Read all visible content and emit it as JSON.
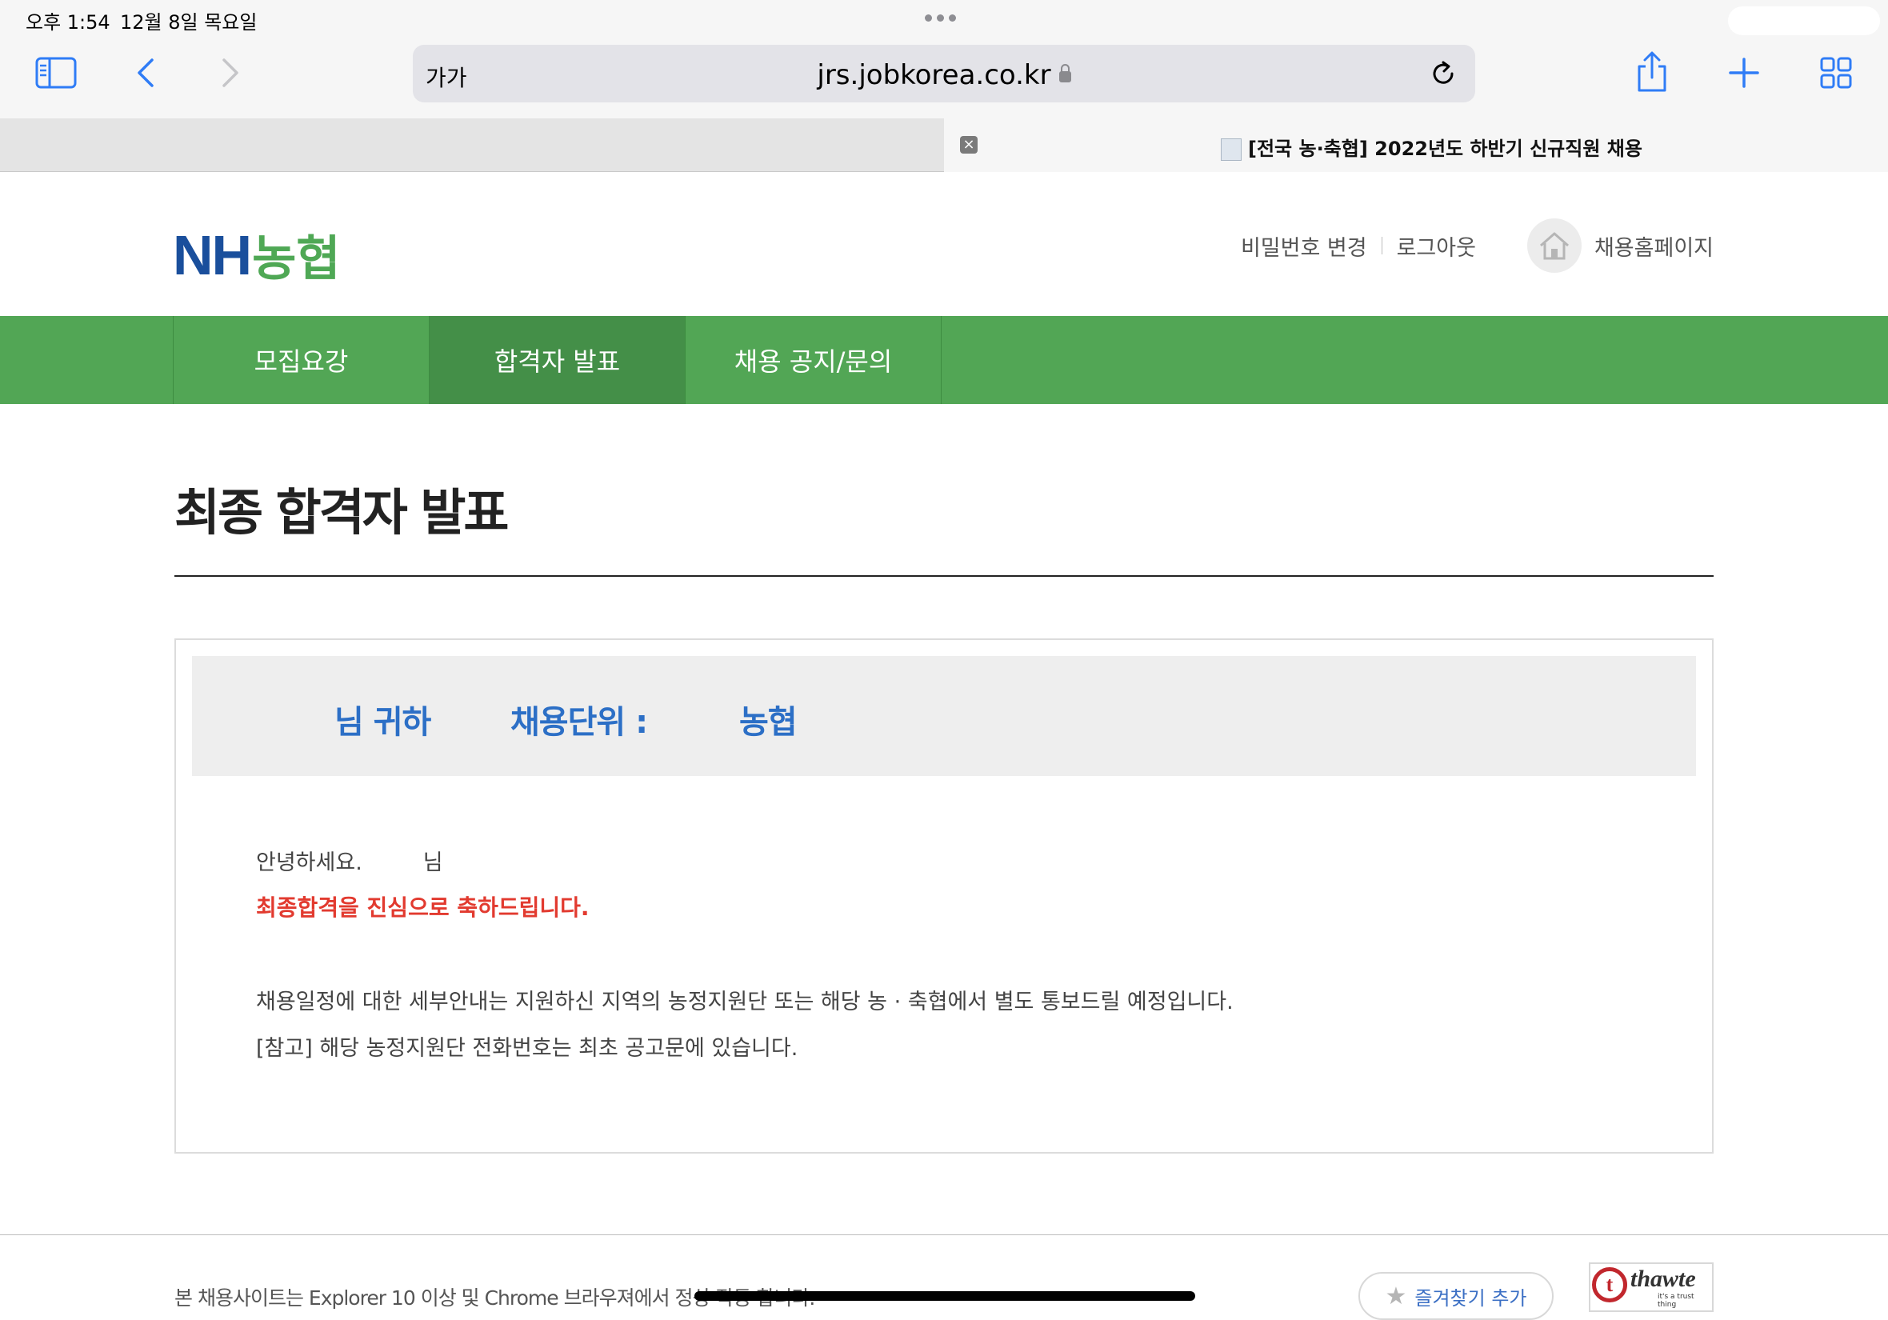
{
  "status_bar": {
    "time": "오후 1:54",
    "date": "12월 8일 목요일"
  },
  "browser": {
    "text_size_label": "가가",
    "url": "jrs.jobkorea.co.kr",
    "tab_title": "[전국 농·축협] 2022년도 하반기 신규직원 채용"
  },
  "header": {
    "logo_nh": "NH",
    "logo_kr": "농협",
    "change_password": "비밀번호 변경",
    "logout": "로그아웃",
    "recruit_home": "채용홈페이지"
  },
  "nav": {
    "items": [
      {
        "label": "모집요강"
      },
      {
        "label": "합격자 발표"
      },
      {
        "label": "채용 공지/문의"
      }
    ],
    "active_index": 1
  },
  "page": {
    "title": "최종 합격자 발표"
  },
  "result": {
    "name_suffix": "님 귀하",
    "unit_label": "채용단위 :",
    "unit_value": "농협",
    "greeting": "안녕하세요.",
    "greeting_suffix": "님",
    "congrats": "최종합격을 진심으로 축하드립니다.",
    "info_line": "채용일정에 대한 세부안내는 지원하신 지역의 농정지원단 또는 해당 농 · 축협에서 별도 통보드릴 예정입니다.",
    "note_line": "[참고] 해당 농정지원단 전화번호는 최초 공고문에 있습니다."
  },
  "footer": {
    "browser_note": "본 채용사이트는 Explorer 10 이상 및 Chrome 브라우져에서 정상 작동 합니다.",
    "bookmark_button": "즐겨찾기 추가",
    "thawte_word": "thawte",
    "thawte_tagline": "it's a trust thing"
  },
  "colors": {
    "nh_blue": "#1a4f9c",
    "nh_green": "#52a655",
    "nav_active": "#448f48",
    "result_blue": "#2c6fc6",
    "congrats_red": "#e23a2f"
  },
  "icons": {
    "sidebar": "sidebar-icon",
    "back": "chevron-left-icon",
    "forward": "chevron-right-icon",
    "lock": "lock-icon",
    "reload": "reload-icon",
    "share": "share-icon",
    "new_tab": "plus-icon",
    "tabs": "tab-overview-icon",
    "home": "home-icon",
    "star": "star-icon"
  }
}
